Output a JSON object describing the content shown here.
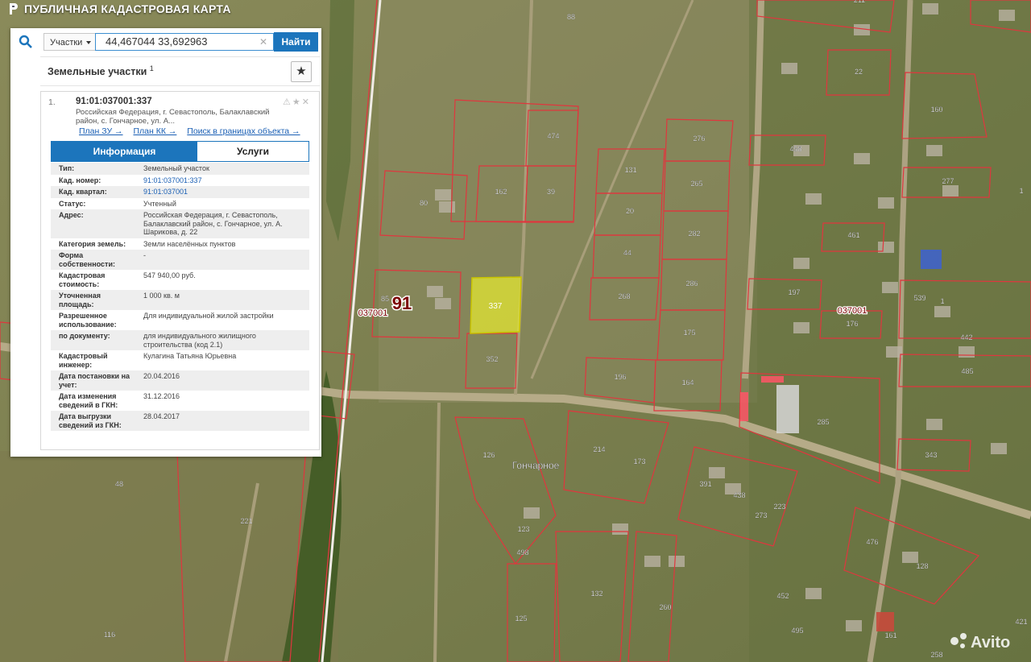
{
  "app": {
    "title": "ПУБЛИЧНАЯ КАДАСТРОВАЯ КАРТА"
  },
  "search": {
    "mode": "Участки",
    "query": "44,467044 33,692963",
    "button": "Найти"
  },
  "section": {
    "title": "Земельные участки",
    "count": "1"
  },
  "result": {
    "index": "1.",
    "cad_number": "91:01:037001:337",
    "address_short": "Российская Федерация, г. Севастополь, Балаклавский район, с. Гончарное, ул. А...",
    "links": [
      "План ЗУ →",
      "План КК →",
      "Поиск в границах объекта →"
    ],
    "tabs": [
      "Информация",
      "Услуги"
    ],
    "fields": [
      {
        "k": "Тип:",
        "v": "Земельный участок"
      },
      {
        "k": "Кад. номер:",
        "v": "91:01:037001:337",
        "link": true
      },
      {
        "k": "Кад. квартал:",
        "v": "91:01:037001",
        "link": true
      },
      {
        "k": "Статус:",
        "v": "Учтенный"
      },
      {
        "k": "Адрес:",
        "v": "Российская Федерация, г. Севастополь, Балаклавский район, с. Гончарное, ул. А. Шарикова, д. 22"
      },
      {
        "k": "Категория земель:",
        "v": "Земли населённых пунктов"
      },
      {
        "k": "Форма собственности:",
        "v": "-"
      },
      {
        "k": "Кадастровая стоимость:",
        "v": "547 940,00 руб."
      },
      {
        "k": "Уточненная площадь:",
        "v": "1 000 кв. м"
      },
      {
        "k": "Разрешенное использование:",
        "v": "Для индивидуальной жилой застройки"
      },
      {
        "k": "по документу:",
        "v": "для индивидуального жилищного строительства (код 2.1)"
      },
      {
        "k": "Кадастровый инженер:",
        "v": "Кулагина Татьяна Юрьевна"
      },
      {
        "k": "Дата постановки на учет:",
        "v": "20.04.2016"
      },
      {
        "k": "Дата изменения сведений в ГКН:",
        "v": "31.12.2016"
      },
      {
        "k": "Дата выгрузки сведений из ГКН:",
        "v": "28.04.2017"
      }
    ]
  },
  "map": {
    "village": "Гончарное",
    "district_number": "91",
    "quarter_labels": [
      "037001",
      "037001"
    ],
    "highlight_parcel": "337",
    "parcel_labels": [
      "88",
      "211",
      "22",
      "160",
      "474",
      "276",
      "162",
      "39",
      "131",
      "265",
      "458",
      "277",
      "80",
      "20",
      "282",
      "461",
      "44",
      "268",
      "286",
      "197",
      "176",
      "85",
      "352",
      "175",
      "539",
      "1",
      "442",
      "196",
      "164",
      "485",
      "132",
      "221",
      "48",
      "126",
      "214",
      "173",
      "391",
      "438",
      "273",
      "223",
      "285",
      "343",
      "123",
      "498",
      "452",
      "260",
      "116",
      "125",
      "161",
      "258",
      "476",
      "128",
      "421",
      "495",
      "1"
    ],
    "avito": "Avito",
    "colors": {
      "boundary": "#e0363e",
      "highlight": "#e3e533",
      "panel_accent": "#1c75bc"
    }
  }
}
